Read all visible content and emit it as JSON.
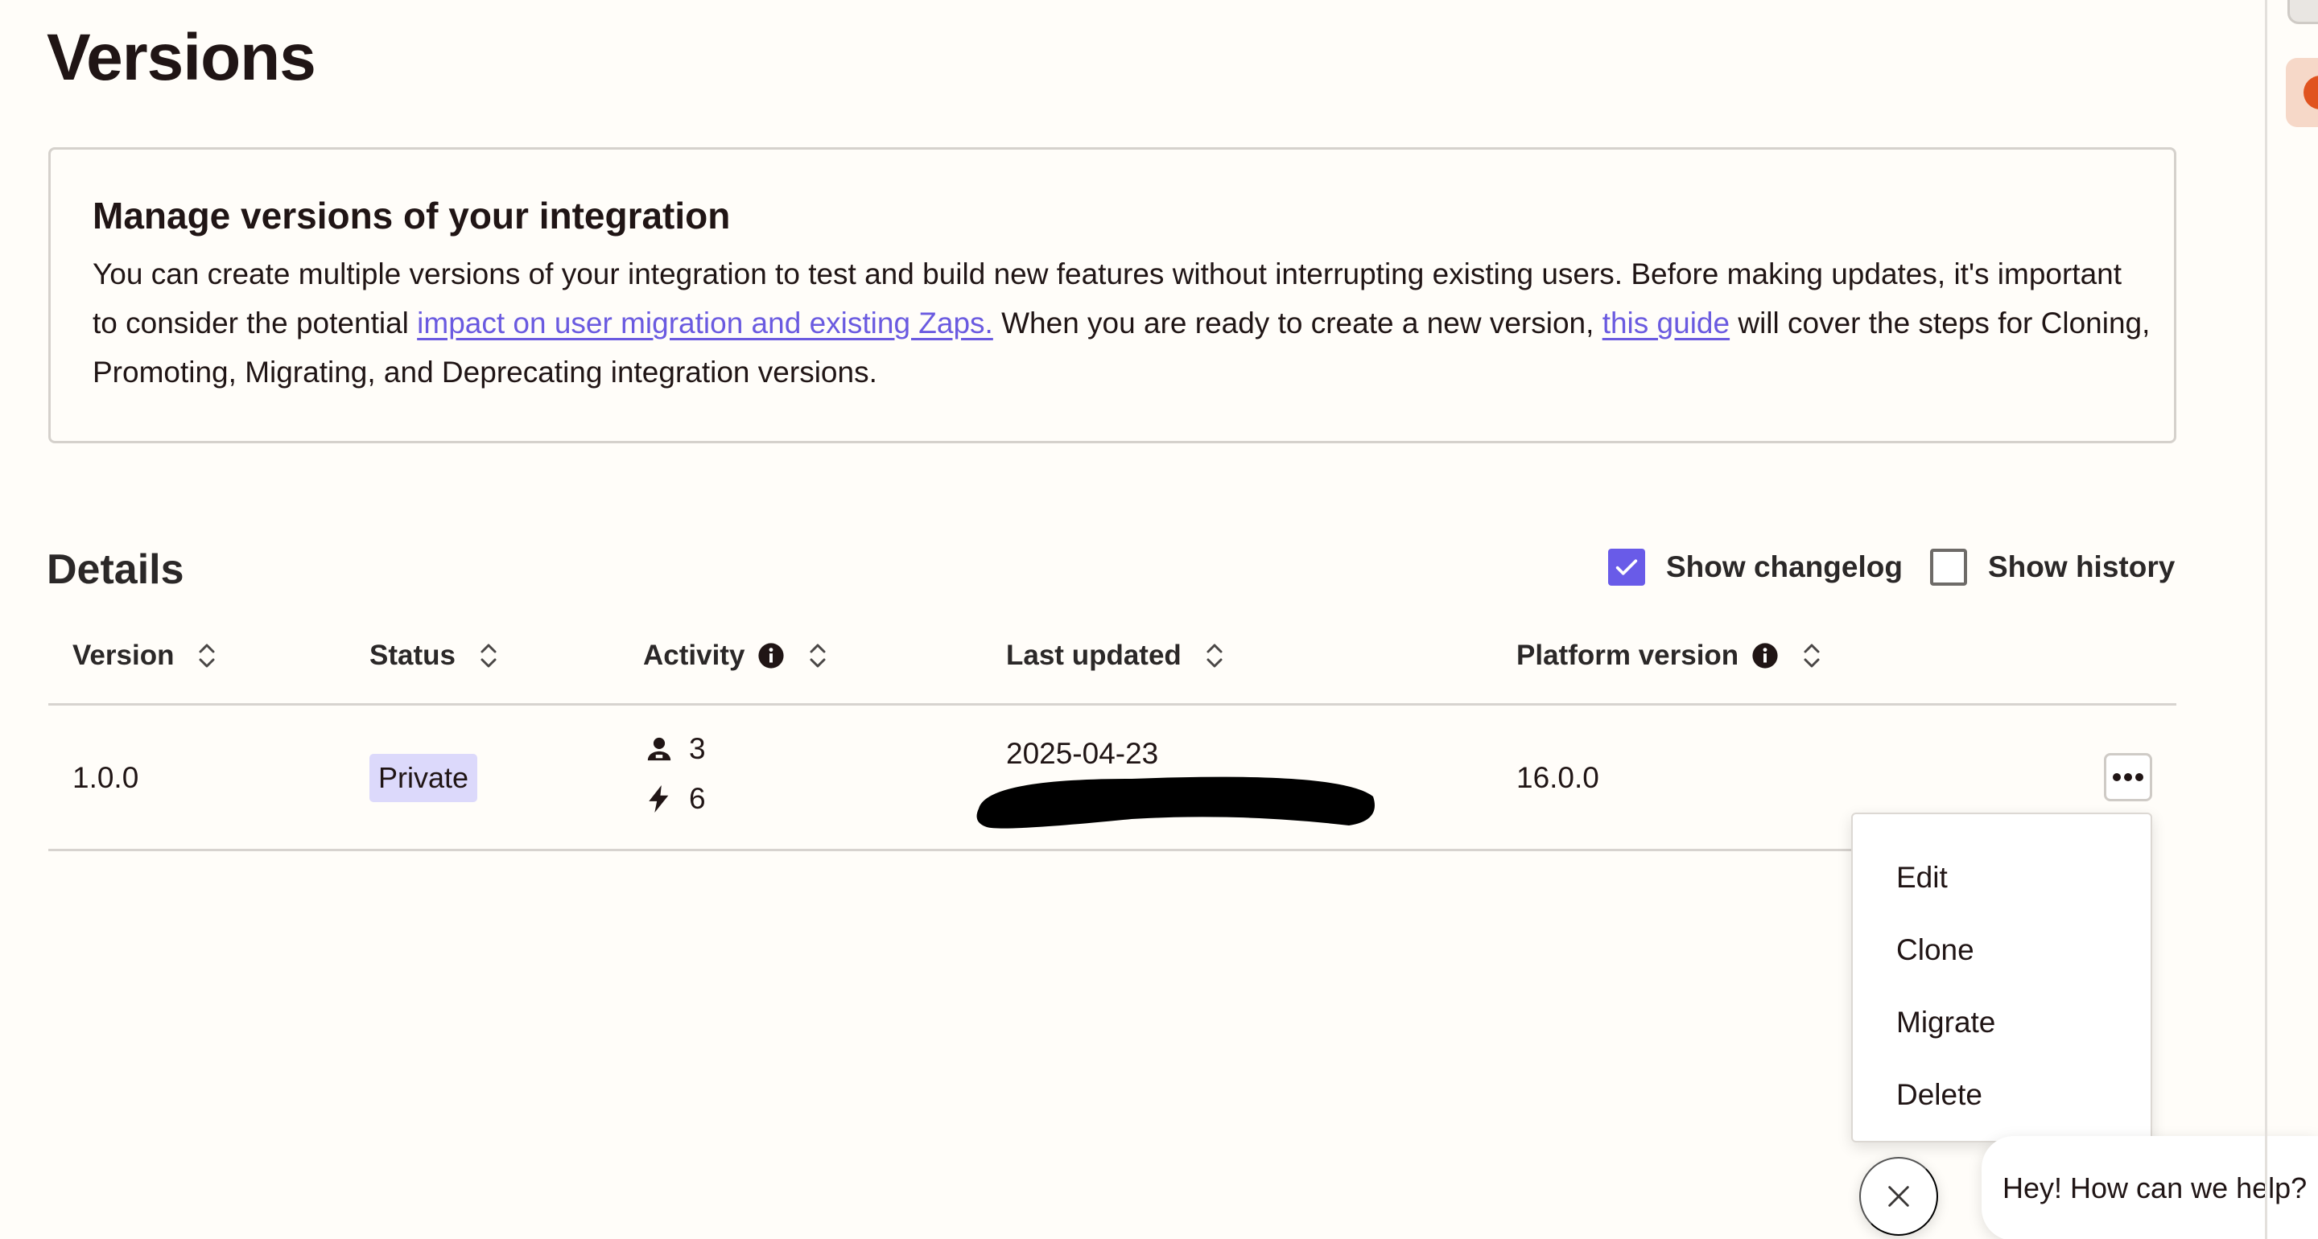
{
  "page": {
    "title": "Versions"
  },
  "info_card": {
    "title": "Manage versions of your integration",
    "text_1": "You can create multiple versions of your integration to test and build new features without interrupting existing users. Before making updates, it's important to consider the potential ",
    "link_1": "impact on user migration and existing Zaps.",
    "text_2": " When you are ready to create a new version, ",
    "link_2": "this guide",
    "text_3": " will cover the steps for Cloning, Promoting, Migrating, and Deprecating integration versions."
  },
  "details": {
    "title": "Details",
    "show_changelog": {
      "label": "Show changelog",
      "checked": true
    },
    "show_history": {
      "label": "Show history",
      "checked": false
    }
  },
  "table": {
    "columns": [
      "Version",
      "Status",
      "Activity",
      "Last updated",
      "Platform version"
    ],
    "rows": [
      {
        "version": "1.0.0",
        "status": "Private",
        "activity_users": "3",
        "activity_zaps": "6",
        "last_updated": "2025-04-23",
        "platform_version": "16.0.0"
      }
    ]
  },
  "menu": {
    "items": [
      "Edit",
      "Clone",
      "Migrate",
      "Delete"
    ]
  },
  "chat": {
    "greeting": "Hey! How can we help?"
  },
  "colors": {
    "accent": "#695be8",
    "link": "#6a5ae0",
    "badge_bg": "#dcd9fb",
    "brand_orange": "#e0531f"
  }
}
